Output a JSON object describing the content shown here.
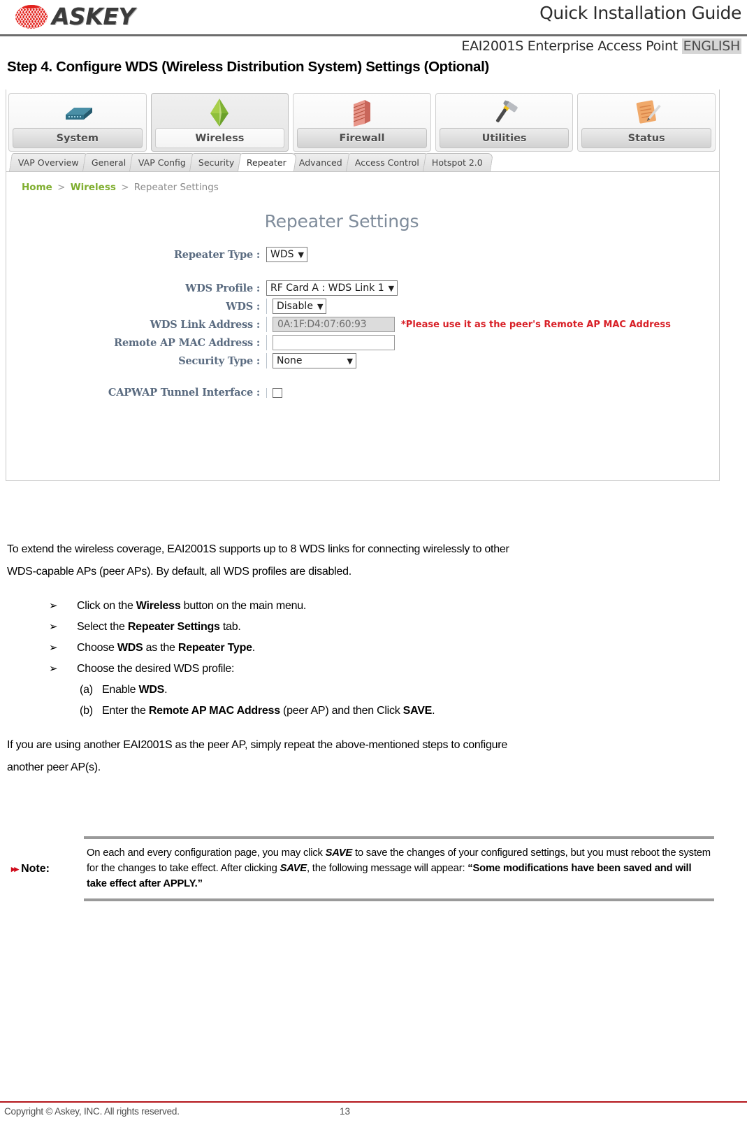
{
  "header": {
    "brand": "ASKEY",
    "guide_title": "Quick Installation Guide",
    "product_line": "EAI2001S Enterprise Access Point",
    "language": "ENGLISH",
    "step_title": "Step 4. Configure WDS (Wireless Distribution System) Settings (Optional)"
  },
  "screenshot": {
    "nav": [
      {
        "label": "System",
        "icon": "router-icon",
        "active": false
      },
      {
        "label": "Wireless",
        "icon": "wireless-icon",
        "active": true
      },
      {
        "label": "Firewall",
        "icon": "firewall-icon",
        "active": false
      },
      {
        "label": "Utilities",
        "icon": "hammer-icon",
        "active": false
      },
      {
        "label": "Status",
        "icon": "document-icon",
        "active": false
      }
    ],
    "tabs": [
      {
        "label": "VAP Overview",
        "active": false
      },
      {
        "label": "General",
        "active": false
      },
      {
        "label": "VAP Config",
        "active": false
      },
      {
        "label": "Security",
        "active": false
      },
      {
        "label": "Repeater",
        "active": true
      },
      {
        "label": "Advanced",
        "active": false
      },
      {
        "label": "Access Control",
        "active": false
      },
      {
        "label": "Hotspot 2.0",
        "active": false
      }
    ],
    "breadcrumb": {
      "home": "Home",
      "section": "Wireless",
      "page": "Repeater Settings",
      "separator": ">"
    },
    "panel_title": "Repeater Settings",
    "fields": {
      "repeater_type_label": "Repeater Type :",
      "repeater_type_value": "WDS",
      "wds_profile_label": "WDS Profile :",
      "wds_profile_value": "RF Card A : WDS Link 1",
      "wds_label": "WDS :",
      "wds_value": "Disable",
      "wds_link_address_label": "WDS Link Address :",
      "wds_link_address_value": "0A:1F:D4:07:60:93",
      "wds_link_address_hint": "*Please use it as the peer's Remote AP MAC Address",
      "remote_ap_mac_label": "Remote AP MAC Address :",
      "remote_ap_mac_value": "",
      "security_type_label": "Security Type :",
      "security_type_value": "None",
      "capwap_label": "CAPWAP Tunnel Interface :",
      "capwap_checked": false
    },
    "accent_green": "#7fae2f",
    "accent_red": "#d81f26",
    "title_color": "#7f8c9b"
  },
  "body": {
    "intro_a": "To extend the wireless coverage, EAI2001S supports up to 8 WDS links for connecting wirelessly to other",
    "intro_b": "WDS-capable APs (peer APs). By default, all WDS profiles are disabled.",
    "bullet_marker": "➢",
    "bullets": [
      {
        "pre": "Click on the ",
        "bold": "Wireless",
        "post": " button on the main menu."
      },
      {
        "pre": "Select the ",
        "bold": "Repeater Settings",
        "post": " tab."
      },
      {
        "pre": "Choose ",
        "bold": "WDS",
        "post": " as the ",
        "bold2": "Repeater Type",
        "post2": "."
      },
      {
        "pre": "Choose the desired WDS profile:",
        "bold": "",
        "post": ""
      }
    ],
    "sub_items": [
      {
        "marker": "(a)",
        "pre": "Enable ",
        "bold": "WDS",
        "post": "."
      },
      {
        "marker": "(b)",
        "pre": "Enter the ",
        "bold": "Remote AP MAC Address",
        "post": " (peer AP) and then Click ",
        "bold2": "SAVE",
        "post2": "."
      }
    ],
    "closing_a": "If you are using another EAI2001S as the peer AP, simply repeat the above-mentioned steps to configure",
    "closing_b": "another peer AP(s)."
  },
  "note": {
    "arrows": "▸▸",
    "label": "Note:",
    "t1": "On each and every configuration page, you may click ",
    "save1": "SAVE",
    "t2": " to save the changes of your configured settings, but you must reboot the system for the changes to take effect. After clicking ",
    "save2": "SAVE",
    "t3": ", the following message will appear: ",
    "quote": "“Some modifications have been saved and will take effect after APPLY.”"
  },
  "footer": {
    "copyright": "Copyright © Askey, INC. All rights reserved.",
    "page_number": "13",
    "rule_color": "#b4161b"
  }
}
